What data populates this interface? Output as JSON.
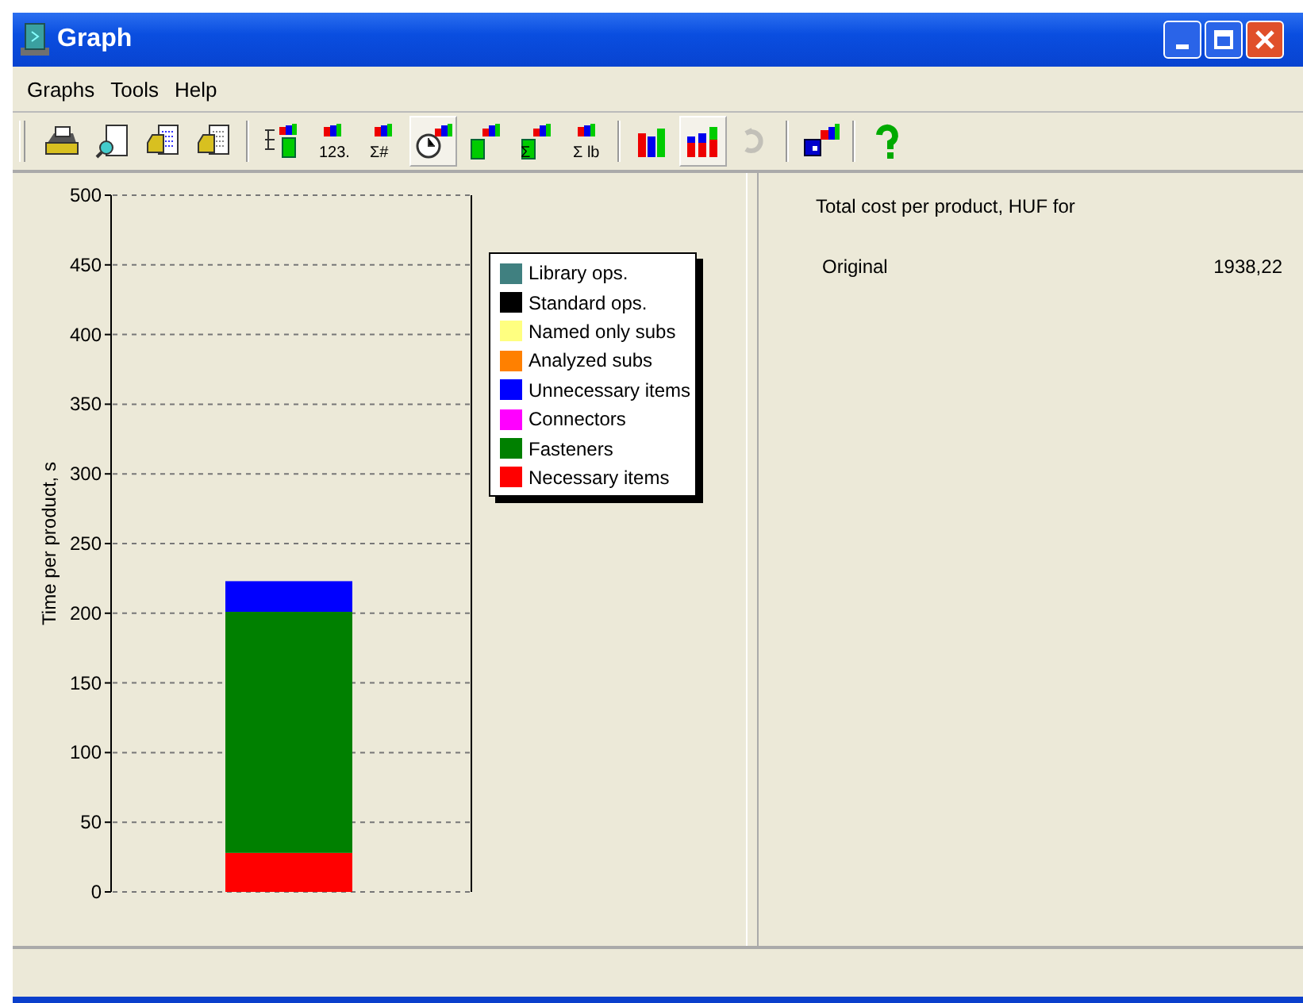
{
  "window": {
    "title": "Graph"
  },
  "menu": [
    "Graphs",
    "Tools",
    "Help"
  ],
  "toolbar": [
    [
      {
        "kind": "print",
        "selected": false,
        "disabled": false
      },
      {
        "kind": "preview",
        "selected": false,
        "disabled": false
      },
      {
        "kind": "doc-list",
        "selected": false,
        "disabled": false
      },
      {
        "kind": "doc-print",
        "selected": false,
        "disabled": false
      }
    ],
    [
      {
        "kind": "tree",
        "selected": false,
        "disabled": false
      },
      {
        "kind": "count",
        "label": "123.",
        "selected": false,
        "disabled": false
      },
      {
        "kind": "sum",
        "label": "Σ#",
        "selected": false,
        "disabled": false
      },
      {
        "kind": "clock",
        "selected": true,
        "disabled": false
      },
      {
        "kind": "parts",
        "selected": false,
        "disabled": false
      },
      {
        "kind": "sum-parts",
        "label": "Σ",
        "selected": false,
        "disabled": false
      },
      {
        "kind": "sum",
        "label": "Σ lb",
        "selected": false,
        "disabled": false
      }
    ],
    [
      {
        "kind": "bars",
        "selected": false,
        "disabled": false
      },
      {
        "kind": "stacked",
        "selected": true,
        "disabled": false
      },
      {
        "kind": "recycle",
        "selected": false,
        "disabled": true
      }
    ],
    [
      {
        "kind": "cubes",
        "selected": false,
        "disabled": false
      }
    ],
    [
      {
        "kind": "help",
        "selected": false,
        "disabled": false
      }
    ]
  ],
  "chart": {
    "chart_data": {
      "type": "bar",
      "stacked": true,
      "grid": true,
      "ylabel": "Time per product, s",
      "ylim": [
        0,
        500
      ],
      "yticks": [
        0,
        50,
        100,
        150,
        200,
        250,
        300,
        350,
        400,
        450,
        500
      ],
      "series": [
        {
          "name": "Library ops.",
          "color": "#408080",
          "values": [
            0
          ]
        },
        {
          "name": "Standard ops.",
          "color": "#000000",
          "values": [
            0
          ]
        },
        {
          "name": "Named only subs",
          "color": "#ffff80",
          "values": [
            0
          ]
        },
        {
          "name": "Analyzed subs",
          "color": "#ff8000",
          "values": [
            0
          ]
        },
        {
          "name": "Unnecessary items",
          "color": "#0000ff",
          "values": [
            22
          ]
        },
        {
          "name": "Connectors",
          "color": "#ff00ff",
          "values": [
            0
          ]
        },
        {
          "name": "Fasteners",
          "color": "#008000",
          "values": [
            173
          ]
        },
        {
          "name": "Necessary items",
          "color": "#ff0000",
          "values": [
            28
          ]
        }
      ]
    }
  },
  "summary": {
    "heading": "Total cost per product, HUF for",
    "rows": [
      {
        "label": "Original",
        "value": "1938,22"
      }
    ]
  }
}
